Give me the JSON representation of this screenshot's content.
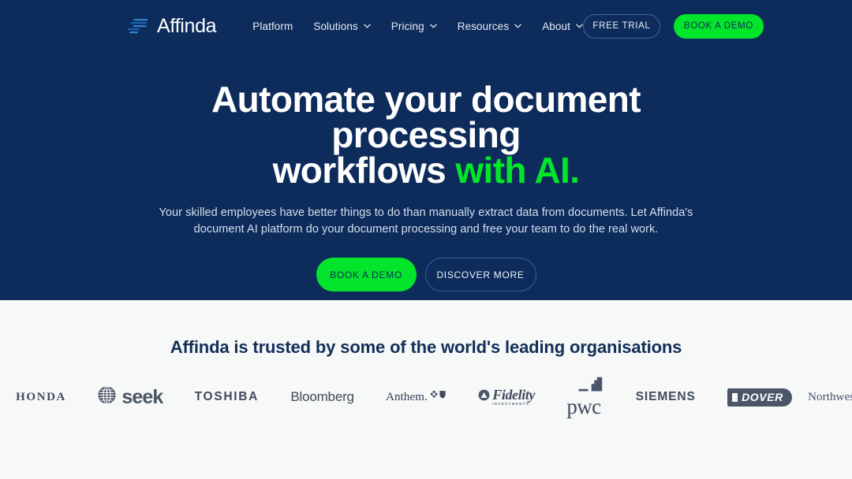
{
  "navbar": {
    "brand": {
      "name": "Affinda",
      "logo_icon": "affinda-lines-logo"
    },
    "links": [
      {
        "label": "Platform",
        "has_dropdown": false
      },
      {
        "label": "Solutions",
        "has_dropdown": true
      },
      {
        "label": "Pricing",
        "has_dropdown": true
      },
      {
        "label": "Resources",
        "has_dropdown": true
      },
      {
        "label": "About",
        "has_dropdown": true
      }
    ],
    "free_trial_label": "FREE TRIAL",
    "book_demo_label": "BOOK A DEMO"
  },
  "hero": {
    "title_line1": "Automate your document processing",
    "title_line2_plain": "workflows ",
    "title_line2_accent": "with AI.",
    "subtitle": "Your skilled employees have better things to do than manually extract data from documents. Let Affinda's document AI platform do your document processing and free your team to do the real work.",
    "primary_cta": "BOOK A DEMO",
    "secondary_cta": "DISCOVER MORE"
  },
  "trusted": {
    "heading": "Affinda is trusted by some of the world's leading organisations",
    "logos": [
      {
        "name": "Honda",
        "text": "HONDA"
      },
      {
        "name": "Seek",
        "text": "seek"
      },
      {
        "name": "Toshiba",
        "text": "TOSHIBA"
      },
      {
        "name": "Bloomberg",
        "text": "Bloomberg"
      },
      {
        "name": "Anthem",
        "text": "Anthem."
      },
      {
        "name": "Fidelity",
        "text": "Fidelity",
        "tagline": "INVESTMENTS"
      },
      {
        "name": "PwC",
        "text": "pwc"
      },
      {
        "name": "Siemens",
        "text": "SIEMENS"
      },
      {
        "name": "Dover",
        "text": "DOVER"
      },
      {
        "name": "Northwestern",
        "text": "Northwestern"
      }
    ]
  },
  "colors": {
    "hero_background": "#0d2c5b",
    "accent_green": "#03e52b",
    "section_background": "#f7f8f8",
    "heading_navy": "#122e59",
    "logo_grey": "#4a5568"
  }
}
